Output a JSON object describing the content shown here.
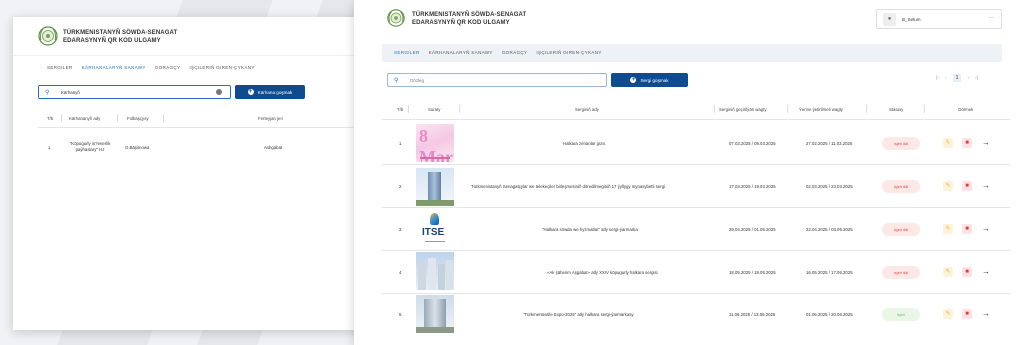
{
  "brand": {
    "line1": "TÜRKMENISTANYŇ SÖWDA-SENAGAT",
    "line2": "EDARASYNYŇ QR KOD ULGAMY"
  },
  "back_window": {
    "tabs": [
      "SERGILER",
      "KÄRHANALARYŇ SANAWY",
      "GORAGÇY",
      "IŞÇILERIŇ GIREN-ÇYKANY"
    ],
    "active_tab": 1,
    "search_value": "Kärhanyň",
    "add_button": "Kärhana goşmak",
    "headers": [
      "T/b",
      "Kärhananyň ady",
      "Folbaşçysy",
      "Ferteyjan jeri"
    ],
    "rows": [
      {
        "no": "1",
        "name_line1": "\"Köpugurly in?enerlik",
        "name_line2": "paýhaslary\" HJ",
        "head": "O.Bäşimowa",
        "place": "Ashgabat"
      }
    ]
  },
  "front_window": {
    "user": {
      "name": "B_Setum",
      "more": "···"
    },
    "tabs": [
      "SERGILER",
      "KÄRHANALARYŇ SANAWY",
      "GORAGÇY",
      "IŞÇILERIŇ GIREN-ÇYKANY"
    ],
    "active_tab": 0,
    "search_placeholder": "Gözleg",
    "add_button": "Sergi goşmak",
    "pager": {
      "first": "|‹",
      "prev": "‹",
      "page": "1",
      "next": "›",
      "last": "›|"
    },
    "headers": [
      "T/b",
      "Suraty",
      "Serginiň ady",
      "Serginiň geçirilýän wagty",
      "Ýerine ýetirilmeli wagty",
      "Statusy",
      "Görmek"
    ],
    "rows": [
      {
        "no": "1",
        "name": "Halkara zenanlar güni.",
        "held": "07.03.2025 / 09.03.2025",
        "due": "27.02.2025 / 11.03.2025",
        "status": "Işjeň däl",
        "status_color": "red",
        "thumb_caption": "8 Mart"
      },
      {
        "no": "2",
        "name": "Türkmenistanyň Senagatçylar we telekeçiler birleşmesiniň döredilmeginiň 17 ýyllygy mynasybetli sergi",
        "held": "17.03.2025 / 19.03.2025",
        "due": "02.03.2025 / 23.03.2025",
        "status": "Işjeň däl",
        "status_color": "red",
        "thumb_caption": ""
      },
      {
        "no": "3",
        "name": "\"Halkara söwda we hyzmatlar\" atly sergi-ýarmarka",
        "held": "29.04.2025 / 01.05.2025",
        "due": "22.04.2025 / 03.05.2025",
        "status": "Işjeň däl",
        "status_color": "red",
        "thumb_caption": "ITSE"
      },
      {
        "no": "4",
        "name": "«Ak şäherim Aşgabat» atly XXIV köpugurly halkara sergisi",
        "held": "18.05.2025 / 19.05.2025",
        "due": "16.05.2025 / 17.06.2025",
        "status": "Işjeň däl",
        "status_color": "red",
        "thumb_caption": ""
      },
      {
        "no": "5",
        "name": "\"Türkmentextile Expo-2025\" atly halkara sergi-ýarmarkasy",
        "held": "11.06.2025 / 13.06.2025",
        "due": "01.06.2025 / 20.06.2025",
        "status": "Işjeň",
        "status_color": "green",
        "thumb_caption": ""
      }
    ]
  },
  "colors": {
    "accent": "#1e6fc2",
    "button": "#0e4c8f",
    "inactive": "#e04545",
    "active": "#6bbf5a"
  }
}
